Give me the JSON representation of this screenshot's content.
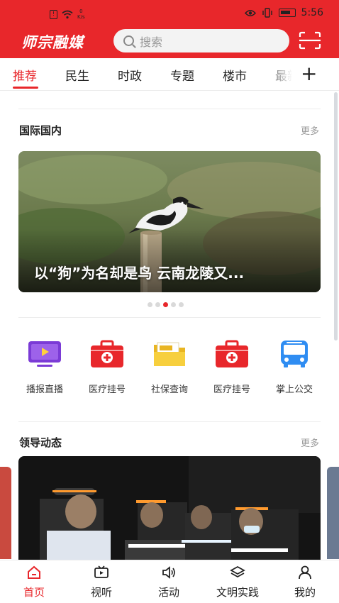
{
  "status_bar": {
    "speed_value": "0",
    "speed_unit": "K/s",
    "time": "5:56"
  },
  "header": {
    "logo_text": "师宗融媒",
    "search_placeholder": "搜索"
  },
  "tabs": [
    {
      "label": "推荐",
      "active": true
    },
    {
      "label": "民生",
      "active": false
    },
    {
      "label": "时政",
      "active": false
    },
    {
      "label": "专题",
      "active": false
    },
    {
      "label": "楼市",
      "active": false
    },
    {
      "label": "最新",
      "active": false
    }
  ],
  "section_intl": {
    "title": "国际国内",
    "more": "更多"
  },
  "banner": {
    "caption": "以“狗”为名却是鸟 云南龙陵又...",
    "slide_count": 5,
    "active_slide": 3
  },
  "services": [
    {
      "label": "播报直播",
      "icon": "tv-play-icon"
    },
    {
      "label": "医疗挂号",
      "icon": "medical-kit-icon"
    },
    {
      "label": "社保查询",
      "icon": "social-security-folder-icon"
    },
    {
      "label": "医疗挂号",
      "icon": "medical-kit-icon"
    },
    {
      "label": "掌上公交",
      "icon": "bus-icon"
    }
  ],
  "section_leader": {
    "title": "领导动态",
    "more": "更多"
  },
  "bottom_nav": [
    {
      "label": "首页",
      "icon": "home-icon",
      "active": true
    },
    {
      "label": "视听",
      "icon": "video-icon",
      "active": false
    },
    {
      "label": "活动",
      "icon": "speaker-icon",
      "active": false
    },
    {
      "label": "文明实践",
      "icon": "layers-icon",
      "active": false
    },
    {
      "label": "我的",
      "icon": "user-icon",
      "active": false
    }
  ],
  "colors": {
    "brand_red": "#e8272b",
    "muted_text": "#999999"
  }
}
